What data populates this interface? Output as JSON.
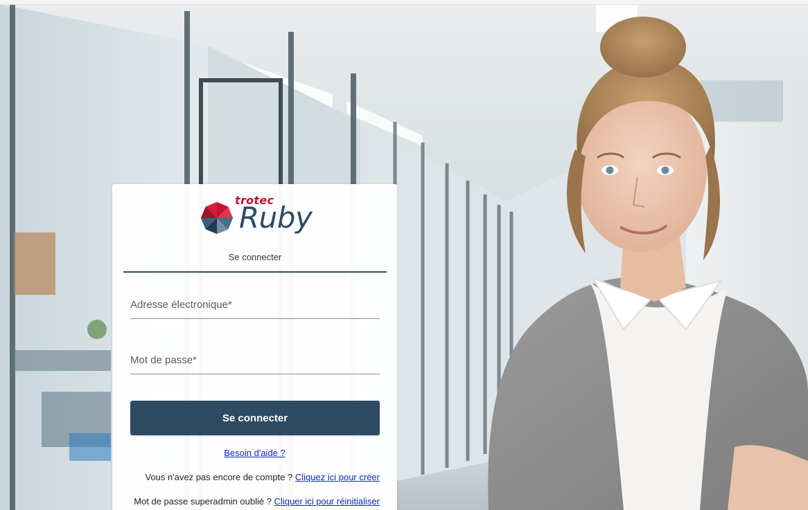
{
  "brand": {
    "company": "trotec",
    "product": "Ruby"
  },
  "login": {
    "tab_label": "Se connecter",
    "email_label": "Adresse électronique*",
    "email_value": "",
    "password_label": "Mot de passe*",
    "password_value": "",
    "submit_label": "Se connecter",
    "help_link": "Besoin d'aide ?",
    "no_account_text": "Vous n'avez pas encore de compte ?",
    "create_link": "Cliquez ici pour créer",
    "forgot_superadmin_text": "Mot de passe superadmin oublié ?",
    "reset_link": "Cliquer ici pour réinitialiser"
  },
  "colors": {
    "accent": "#2e4b63",
    "brand_red": "#c8102e",
    "link": "#0a27c4"
  },
  "icons": {
    "logo": "octagon-umbrella-logo"
  }
}
